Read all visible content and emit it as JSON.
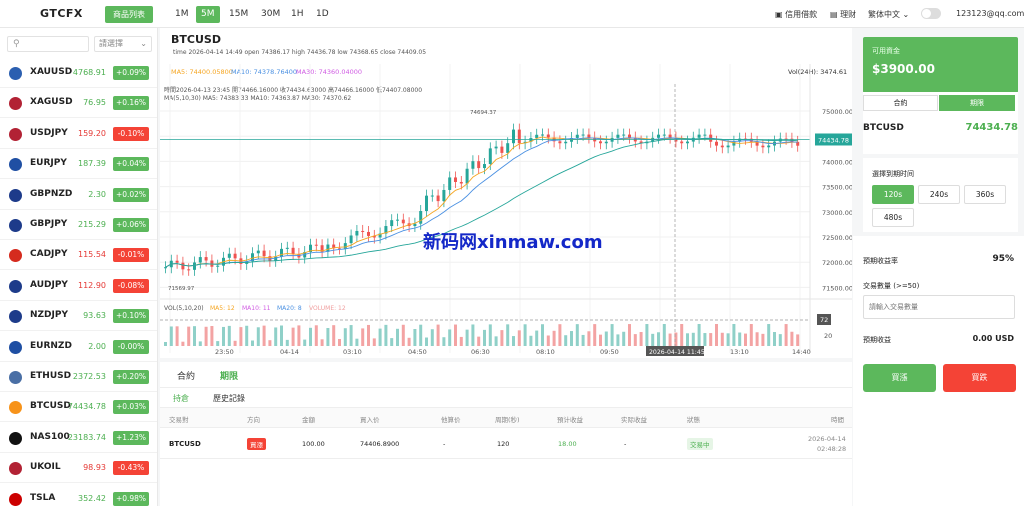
{
  "topbar": {
    "logo": "GTCFX",
    "product_list": "商品列表",
    "timeframes": [
      "1M",
      "5M",
      "15M",
      "30M",
      "1H",
      "1D"
    ],
    "active_timeframe": "5M",
    "credit": "信用借款",
    "finance": "理财",
    "language": "繁体中文",
    "email": "123123@qq.com"
  },
  "sidebar": {
    "search_placeholder": "",
    "select_label": "請選擇",
    "items": [
      {
        "symbol": "XAUUSD",
        "price": "4768.91",
        "change": "+0.09%",
        "dir": "up",
        "color": "#2b5fb0"
      },
      {
        "symbol": "XAGUSD",
        "price": "76.95",
        "change": "+0.16%",
        "dir": "up",
        "color": "#b22234"
      },
      {
        "symbol": "USDJPY",
        "price": "159.20",
        "change": "-0.10%",
        "dir": "down",
        "color": "#b22234"
      },
      {
        "symbol": "EURJPY",
        "price": "187.39",
        "change": "+0.04%",
        "dir": "up",
        "color": "#1f4fa3"
      },
      {
        "symbol": "GBPNZD",
        "price": "2.30",
        "change": "+0.02%",
        "dir": "up",
        "color": "#1d3b8a"
      },
      {
        "symbol": "GBPJPY",
        "price": "215.29",
        "change": "+0.06%",
        "dir": "up",
        "color": "#1d3b8a"
      },
      {
        "symbol": "CADJPY",
        "price": "115.54",
        "change": "-0.01%",
        "dir": "down",
        "color": "#d52b1e"
      },
      {
        "symbol": "AUDJPY",
        "price": "112.90",
        "change": "-0.08%",
        "dir": "down",
        "color": "#1d3b8a"
      },
      {
        "symbol": "NZDJPY",
        "price": "93.63",
        "change": "+0.10%",
        "dir": "up",
        "color": "#1d3b8a"
      },
      {
        "symbol": "EURNZD",
        "price": "2.00",
        "change": "-0.00%",
        "dir": "up",
        "color": "#1f4fa3"
      },
      {
        "symbol": "ETHUSD",
        "price": "2372.53",
        "change": "+0.20%",
        "dir": "up",
        "color": "#4a6fa5"
      },
      {
        "symbol": "BTCUSD",
        "price": "74434.78",
        "change": "+0.03%",
        "dir": "up",
        "color": "#f7931a"
      },
      {
        "symbol": "NAS100",
        "price": "23183.74",
        "change": "+1.23%",
        "dir": "up",
        "color": "#111111"
      },
      {
        "symbol": "UKOIL",
        "price": "98.93",
        "change": "-0.43%",
        "dir": "down",
        "color": "#b22234"
      },
      {
        "symbol": "TSLA",
        "price": "352.42",
        "change": "+0.98%",
        "dir": "up",
        "color": "#cc0000"
      }
    ]
  },
  "chart": {
    "symbol": "BTCUSD",
    "ohlc_line": "time 2026-04-14 14:49   open 74386.17   high 74436.78   low 74368.65   close 74409.05",
    "ma5": "MA5: 74400.05800",
    "ma10": "MA10: 74378.76400",
    "ma30": "MA30: 74360.04000",
    "vol24h": "Vol(24H): 3474.61",
    "tooltip1": "時間2026-04-13 23:45   開74466.16000   收74434.63000   高74466.16000   低74407.08000",
    "tooltip2": "MA(5,10,30)    MA5: 74383.33    MA10: 74363.87    MA30: 74370.62",
    "high_label": "74694.37",
    "low_label": "71569.97",
    "current_price": "74434.78",
    "price_ticks": [
      "75000.00",
      "74500.00",
      "74000.00",
      "73500.00",
      "73000.00",
      "72500.00",
      "72000.00",
      "71500.00"
    ],
    "vol_header": "VOL(5,10,20)",
    "vol_ma5": "MA5: 12",
    "vol_ma10": "MA10: 11",
    "vol_ma20": "MA20: 8",
    "vol_volume": "VOLUME: 12",
    "vol_tick": "20",
    "vol_cursor": "72",
    "time_ticks": [
      "23:50",
      "04-14",
      "03:10",
      "04:50",
      "06:30",
      "08:10",
      "09:50",
      "13:10",
      "14:40"
    ],
    "time_cursor": "2026-04-14 11:45",
    "watermark": "新码网xinmaw.com"
  },
  "chart_data": {
    "type": "candlestick",
    "series": [
      {
        "name": "MA5",
        "color": "#f5a623"
      },
      {
        "name": "MA10",
        "color": "#4a90e2"
      },
      {
        "name": "MA30",
        "color": "#d05ce3"
      }
    ],
    "y_range": [
      71400,
      75200
    ]
  },
  "bottom": {
    "tabs": [
      "合約",
      "期限"
    ],
    "subtabs": [
      "持倉",
      "歷史記錄"
    ],
    "headers": [
      "交易對",
      "方向",
      "金額",
      "買入价",
      "他算价",
      "周期(秒)",
      "預计收益",
      "实际收益",
      "狀態",
      "時間"
    ],
    "rows": [
      {
        "pair": "BTCUSD",
        "direction": "買漲",
        "amount": "100.00",
        "buy": "74406.8900",
        "calc": "-",
        "period": "120",
        "expected": "18.00",
        "actual": "-",
        "status": "交易中",
        "date": "2026-04-14",
        "time": "02:48:28"
      }
    ]
  },
  "right": {
    "balance_label": "可用資金",
    "balance": "$3900.00",
    "tabs": [
      "合約",
      "期限"
    ],
    "pair": "BTCUSD",
    "price": "74434.78",
    "choose_label": "選擇到期时间",
    "durations": [
      "120s",
      "240s",
      "360s",
      "480s"
    ],
    "yield_label": "預期收益率",
    "yield_value": "95%",
    "qty_label": "交易數量 (>=50)",
    "qty_placeholder": "請輸入交易數量",
    "profit_label": "預期收益",
    "profit_value": "0.00 USD",
    "buy_up": "買漲",
    "buy_down": "買跌"
  }
}
